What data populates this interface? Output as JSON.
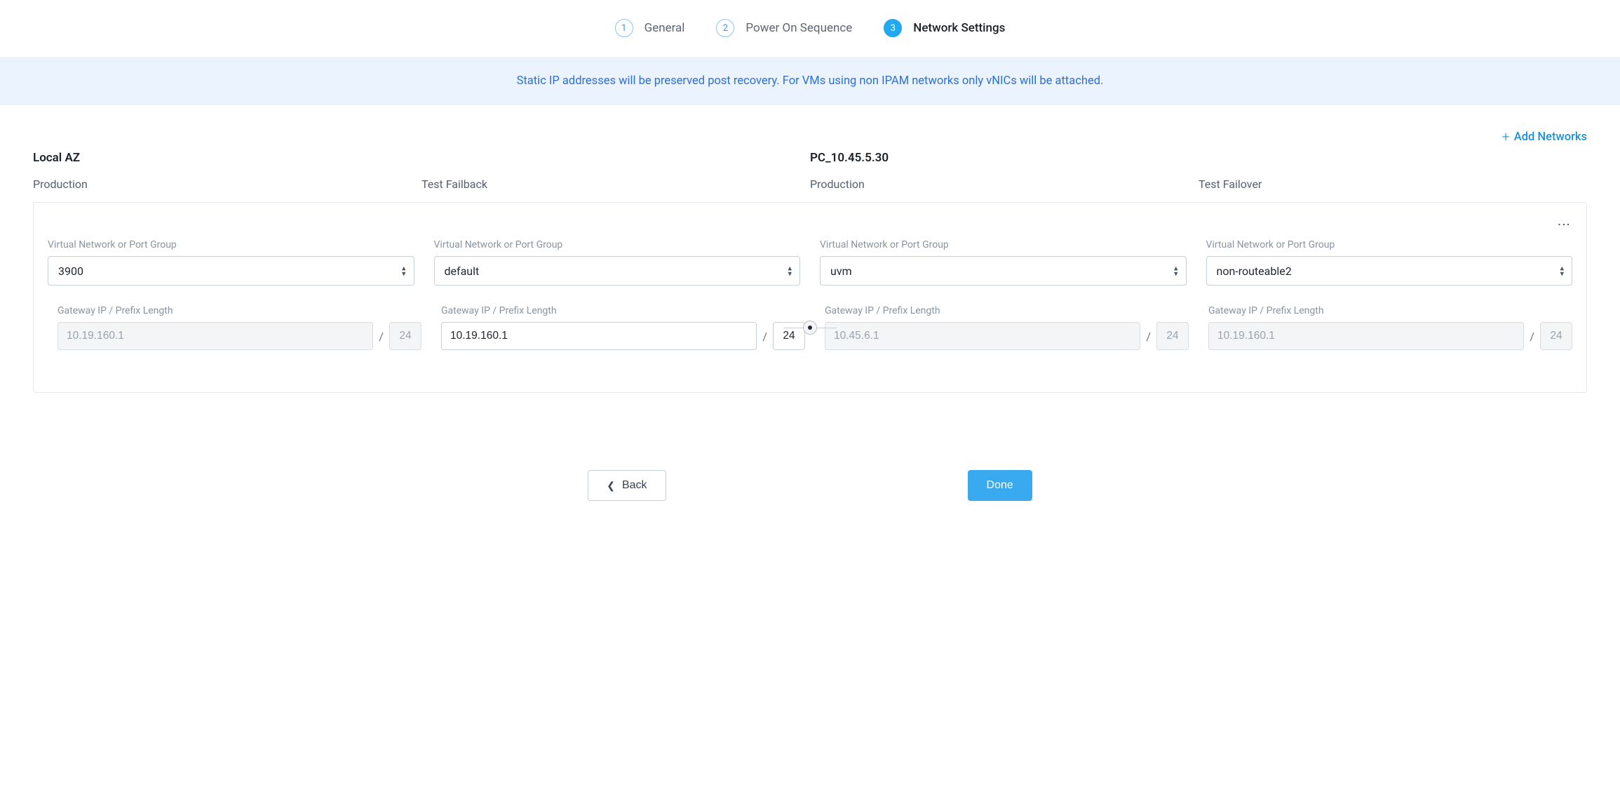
{
  "stepper": {
    "steps": [
      {
        "num": "1",
        "label": "General"
      },
      {
        "num": "2",
        "label": "Power On Sequence"
      },
      {
        "num": "3",
        "label": "Network Settings"
      }
    ]
  },
  "banner": "Static IP addresses will be preserved post recovery. For VMs using non IPAM networks only vNICs will be attached.",
  "addNetworks": "Add Networks",
  "leftAz": {
    "title": "Local AZ",
    "cols": {
      "prod": "Production",
      "test": "Test Failback"
    }
  },
  "rightAz": {
    "title": "PC_10.45.5.30",
    "cols": {
      "prod": "Production",
      "test": "Test Failover"
    }
  },
  "labels": {
    "network": "Virtual Network or Port Group",
    "gateway": "Gateway IP / Prefix Length"
  },
  "fields": {
    "leftProd": {
      "network": "3900",
      "gateway": "10.19.160.1",
      "prefix": "24",
      "gatewayEditable": false
    },
    "leftTest": {
      "network": "default",
      "gateway": "10.19.160.1",
      "prefix": "24",
      "gatewayEditable": true
    },
    "rightProd": {
      "network": "uvm",
      "gateway": "10.45.6.1",
      "prefix": "24",
      "gatewayEditable": false
    },
    "rightTest": {
      "network": "non-routeable2",
      "gateway": "10.19.160.1",
      "prefix": "24",
      "gatewayEditable": false
    }
  },
  "footer": {
    "back": "Back",
    "done": "Done"
  }
}
